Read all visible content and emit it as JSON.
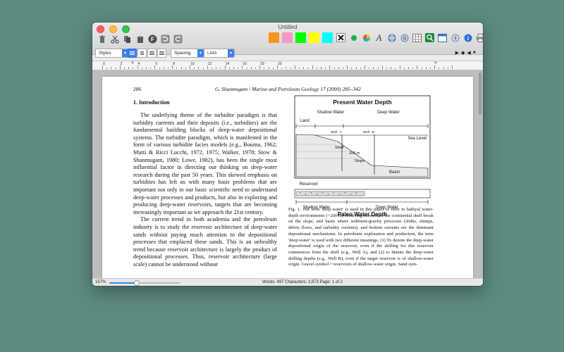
{
  "window": {
    "title": "Untitled"
  },
  "toolbar": {
    "left_icons": [
      "trash-icon",
      "scissors-icon",
      "copy-icon",
      "paste-icon",
      "font-icon",
      "undo-icon",
      "redo-icon"
    ],
    "colors": [
      "#f7941d",
      "#f49ac2",
      "#00ff00",
      "#ffff00",
      "#00ffff"
    ],
    "right_icons": [
      "clear-format-icon",
      "color-dot-icon",
      "color-wheel-icon",
      "font-style-icon",
      "globe-icon",
      "link-icon",
      "table-icon",
      "search-icon",
      "window-icon",
      "emoji-icon",
      "info-icon",
      "print-icon"
    ]
  },
  "format": {
    "styles_label": "Styles",
    "spacing_label": "Spacing",
    "lists_label": "Lists"
  },
  "ruler": {
    "numbers": [
      "0",
      "2",
      "4",
      "6",
      "8",
      "10",
      "12",
      "14",
      "16",
      "18",
      "20"
    ]
  },
  "document": {
    "page_number": "286",
    "running_head": "G. Shanmugam / Marine and Petroleum Geology 17 (2000) 285–342",
    "section_title": "1.  Introduction",
    "paragraphs": [
      "The underlying theme of the turbidite paradigm is that turbidity currents and their deposits (i.e., turbidites) are the fundamental building blocks of deep-water depositional systems. The turbidite paradigm, which is manifested in the form of various turbidite facies models (e.g., Bouma, 1962; Mutti & Ricci Lucchi, 1972, 1975; Walker, 1978; Stow & Shanmugam, 1980; Lowe, 1982), has been the single most influential factor in directing our thinking on deep-water research during the past 50 years. This skewed emphasis on turbidites has left us with many basic problems that are important not only to our basic scientific need to understand deep-water processes and products, but also in exploring and producing deep-water reservoirs, targets that are becoming increasingly important as we approach the 21st century.",
      "The current trend in both academia and the petroleum industry is to study the reservoir architecture of deep-water sands without paying much attention to the depositional processes that emplaced these sands. This is an unhealthy trend because reservoir architecture is largely the product of depositional processes. Thus, reservoir architecture (large scale) cannot be understood without"
    ],
    "figure": {
      "title_top": "Present Water Depth",
      "land": "Land",
      "shallow_water": "Shallow Water",
      "deep_water": "Deep Water",
      "well_a": "Well - A",
      "well_b": "Well - B",
      "sea_level": "Sea Level",
      "shelf": "Shelf",
      "depth": "200 m",
      "slope": "Slope",
      "basin": "Basin",
      "reservoir": "Reservoir",
      "shallow_water_bottom": "Shallow Water",
      "deep_water_bottom": "Deep Water",
      "title_bottom": "Paleo Water Depth"
    },
    "caption": "Fig. 1. The term 'deep-water' is used in this paper to refer to bathyal water-depth environments (>200 m) occurring seaward of the continental shelf break on the slope, and basin where sediment-gravity processes (slides, slumps, debris flows, and turbidity currents), and bottom currents are the dominant depositional mechanisms. In petroleum exploration and production, the term 'deep-water' is used with two different meanings. (1) To denote the deep-water depositional origin of the reservoir, even if the drilling for this reservoir commences from the shelf (e.g., Well A), and (2) to denote the deep-water drilling depths (e.g., Well B), even if the target reservoir is of shallow-water origin. Gravel symbol = reservoirs of shallow-water origin. Sand sym-"
  },
  "status": {
    "zoom": "157%",
    "zoom_fraction": 0.38,
    "stats": "Words: 497  Characters: 2,873  Page: 1 of 2"
  }
}
